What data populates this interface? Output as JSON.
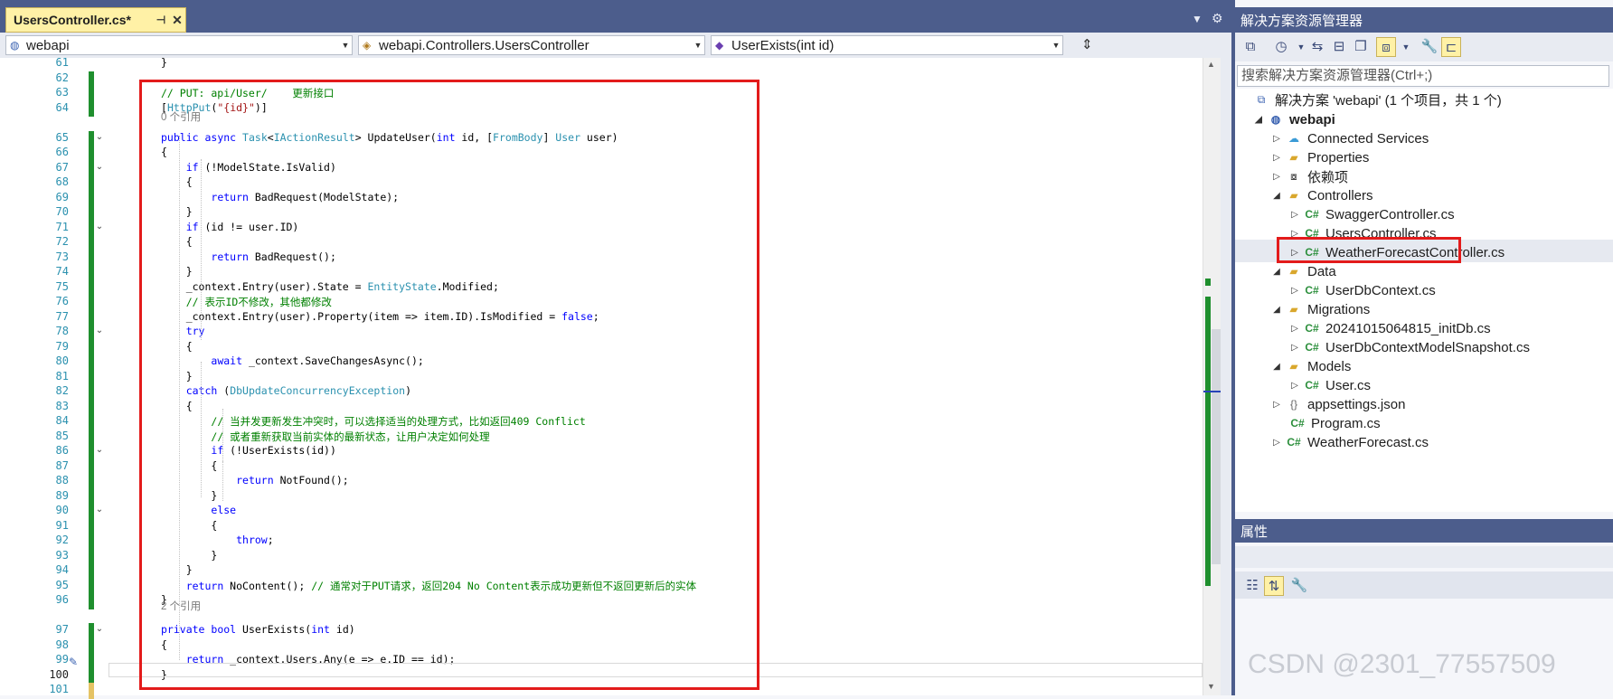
{
  "editor": {
    "tab": {
      "title": "UsersController.cs*",
      "pin": "⊣",
      "close": "✕"
    },
    "nav": {
      "project": "webapi",
      "class": "webapi.Controllers.UsersController",
      "member": "UserExists(int id)"
    },
    "lines": [
      {
        "n": "61",
        "code": "}"
      },
      {
        "n": "62",
        "code": ""
      },
      {
        "n": "63",
        "code": "// PUT: api/User/    更新接口"
      },
      {
        "n": "64",
        "code": "[HttpPut(\"{id}\")]"
      },
      {
        "n": "65",
        "code": "public async Task<IActionResult> UpdateUser(int id, [FromBody] User user)"
      },
      {
        "n": "66",
        "code": "{"
      },
      {
        "n": "67",
        "code": "    if (!ModelState.IsValid)"
      },
      {
        "n": "68",
        "code": "    {"
      },
      {
        "n": "69",
        "code": "        return BadRequest(ModelState);"
      },
      {
        "n": "70",
        "code": "    }"
      },
      {
        "n": "71",
        "code": "    if (id != user.ID)"
      },
      {
        "n": "72",
        "code": "    {"
      },
      {
        "n": "73",
        "code": "        return BadRequest();"
      },
      {
        "n": "74",
        "code": "    }"
      },
      {
        "n": "75",
        "code": "    _context.Entry(user).State = EntityState.Modified;"
      },
      {
        "n": "76",
        "code": "    // 表示ID不修改，其他都修改"
      },
      {
        "n": "77",
        "code": "    _context.Entry(user).Property(item => item.ID).IsModified = false;"
      },
      {
        "n": "78",
        "code": "    try"
      },
      {
        "n": "79",
        "code": "    {"
      },
      {
        "n": "80",
        "code": "        await _context.SaveChangesAsync();"
      },
      {
        "n": "81",
        "code": "    }"
      },
      {
        "n": "82",
        "code": "    catch (DbUpdateConcurrencyException)"
      },
      {
        "n": "83",
        "code": "    {"
      },
      {
        "n": "84",
        "code": "        // 当并发更新发生冲突时，可以选择适当的处理方式，比如返回409 Conflict"
      },
      {
        "n": "85",
        "code": "        // 或者重新获取当前实体的最新状态，让用户决定如何处理"
      },
      {
        "n": "86",
        "code": "        if (!UserExists(id))"
      },
      {
        "n": "87",
        "code": "        {"
      },
      {
        "n": "88",
        "code": "            return NotFound();"
      },
      {
        "n": "89",
        "code": "        }"
      },
      {
        "n": "90",
        "code": "        else"
      },
      {
        "n": "91",
        "code": "        {"
      },
      {
        "n": "92",
        "code": "            throw;"
      },
      {
        "n": "93",
        "code": "        }"
      },
      {
        "n": "94",
        "code": "    }"
      },
      {
        "n": "95",
        "code": "    return NoContent(); // 通常对于PUT请求，返回204 No Content表示成功更新但不返回更新后的实体"
      },
      {
        "n": "96",
        "code": "}"
      },
      {
        "n": "97",
        "code": "private bool UserExists(int id)"
      },
      {
        "n": "98",
        "code": "{"
      },
      {
        "n": "99",
        "code": "    return _context.Users.Any(e => e.ID == id);"
      },
      {
        "n": "100",
        "code": "}"
      },
      {
        "n": "101",
        "code": ""
      }
    ],
    "refs": {
      "update_user": "0 个引用",
      "user_exists": "2 个引用"
    }
  },
  "solution_explorer": {
    "title": "解决方案资源管理器",
    "search_placeholder": "搜索解决方案资源管理器(Ctrl+;)",
    "solution_label": "解决方案 'webapi' (1 个项目，共 1 个)",
    "project": "webapi",
    "items": {
      "connected": "Connected Services",
      "properties": "Properties",
      "deps": "依赖项",
      "controllers": "Controllers",
      "swagger": "SwaggerController.cs",
      "users": "UsersController.cs",
      "weather_ctrl": "WeatherForecastController.cs",
      "data": "Data",
      "dbcontext": "UserDbContext.cs",
      "migrations": "Migrations",
      "initdb": "20241015064815_initDb.cs",
      "snapshot": "UserDbContextModelSnapshot.cs",
      "models": "Models",
      "user": "User.cs",
      "appsettings": "appsettings.json",
      "program": "Program.cs",
      "weather": "WeatherForecast.cs",
      "cs_glyph": "C#"
    }
  },
  "properties": {
    "title": "属性"
  },
  "watermark": "CSDN @2301_77557509"
}
